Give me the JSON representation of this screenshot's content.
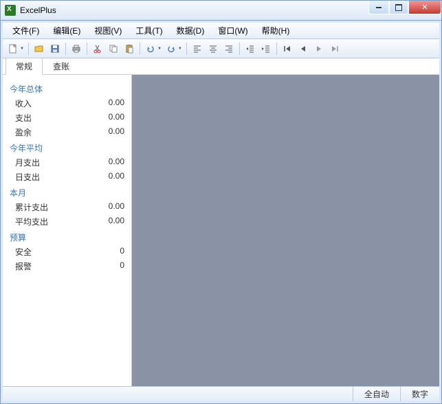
{
  "app": {
    "title": "ExcelPlus"
  },
  "menu": {
    "file": "文件(F)",
    "edit": "编辑(E)",
    "view": "视图(V)",
    "tools": "工具(T)",
    "data": "数据(D)",
    "window": "窗口(W)",
    "help": "帮助(H)"
  },
  "tabs": {
    "general": "常规",
    "ledger": "查账"
  },
  "sidebar": {
    "section1": {
      "title": "今年总体",
      "income_label": "收入",
      "income_val": "0.00",
      "expense_label": "支出",
      "expense_val": "0.00",
      "surplus_label": "盈余",
      "surplus_val": "0.00"
    },
    "section2": {
      "title": "今年平均",
      "monthly_label": "月支出",
      "monthly_val": "0.00",
      "daily_label": "日支出",
      "daily_val": "0.00"
    },
    "section3": {
      "title": "本月",
      "cum_label": "累计支出",
      "cum_val": "0.00",
      "avg_label": "平均支出",
      "avg_val": "0.00"
    },
    "section4": {
      "title": "预算",
      "safe_label": "安全",
      "safe_val": "0",
      "警_label": "报警",
      "警_val": "0"
    }
  },
  "status": {
    "auto": "全自动",
    "num": "数字"
  }
}
